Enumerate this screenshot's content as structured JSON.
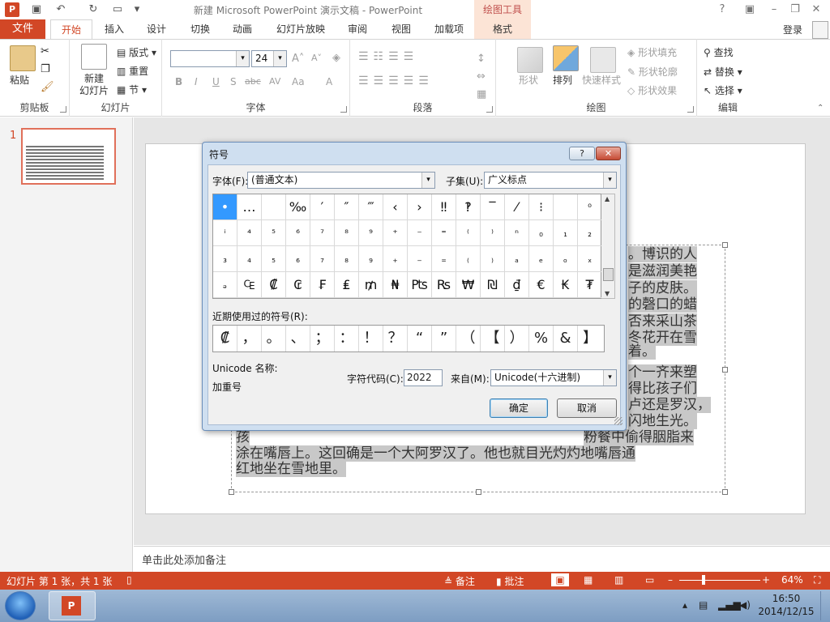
{
  "window": {
    "title": "新建 Microsoft PowerPoint 演示文稿 - PowerPoint",
    "contextual_tab_group": "绘图工具",
    "help": "?",
    "login": "登录"
  },
  "tabs": [
    "文件",
    "开始",
    "插入",
    "设计",
    "切换",
    "动画",
    "幻灯片放映",
    "审阅",
    "视图",
    "加载项",
    "格式"
  ],
  "ribbon": {
    "clipboard": {
      "label": "剪贴板",
      "paste": "粘贴"
    },
    "slides": {
      "label": "幻灯片",
      "new_slide": "新建\n幻灯片",
      "layout": "版式",
      "reset": "重置",
      "section": "节"
    },
    "font": {
      "label": "字体",
      "size": "24",
      "bold": "B",
      "italic": "I",
      "underline": "U",
      "shadow": "S",
      "strike": "abc",
      "spacing": "AV",
      "case": "Aa",
      "color": "A"
    },
    "paragraph": {
      "label": "段落"
    },
    "drawing": {
      "label": "绘图",
      "shapes": "形状",
      "arrange": "排列",
      "quick_styles": "快速样式",
      "fill": "形状填充",
      "outline": "形状轮廓",
      "effects": "形状效果"
    },
    "editing": {
      "label": "编辑",
      "find": "查找",
      "replace": "替换",
      "select": "选择"
    }
  },
  "slide_pane": {
    "slide_number": "1"
  },
  "slide": {
    "lines": [
      "。博识的人",
      "是滋润美艳",
      "子的皮肤。",
      "的磬口的蜡",
      "否来采山茶",
      "冬花开在雪",
      "着。",
      "个一齐来塑",
      "得比孩子们",
      "卢还是罗汉，",
      "闪地生光。",
      "孩",
      "粉餐中偷得胭脂来",
      "涂在嘴唇上。这回确是一个大阿罗汉了。他也就目光灼灼地嘴唇通",
      "红地坐在雪地里。"
    ]
  },
  "notes": {
    "placeholder": "单击此处添加备注"
  },
  "statusbar": {
    "slide_info": "幻灯片 第 1 张，共 1 张",
    "notes": "备注",
    "comments": "批注",
    "zoom": "64%"
  },
  "taskbar": {
    "time": "16:50",
    "date": "2014/12/15"
  },
  "dialog": {
    "title": "符号",
    "help_button": "?",
    "close_button": "✕",
    "font_label": "字体(F):",
    "font_value": "(普通文本)",
    "subset_label": "子集(U):",
    "subset_value": "广义标点",
    "symbols": [
      [
        "•",
        "…",
        "",
        "‰",
        "′",
        "″",
        "‴",
        "‹",
        "›",
        "‼",
        "‽",
        "‾",
        "⁄",
        "⁝",
        "",
        "⁰"
      ],
      [
        "ⁱ",
        "⁴",
        "⁵",
        "⁶",
        "⁷",
        "⁸",
        "⁹",
        "⁺",
        "⁻",
        "⁼",
        "⁽",
        "⁾",
        "ⁿ",
        "₀",
        "₁",
        "₂"
      ],
      [
        "₃",
        "₄",
        "₅",
        "₆",
        "₇",
        "₈",
        "₉",
        "₊",
        "₋",
        "₌",
        "₍",
        "₎",
        "ₐ",
        "ₑ",
        "ₒ",
        "ₓ"
      ],
      [
        "ₔ",
        "₠",
        "₡",
        "₢",
        "₣",
        "₤",
        "₥",
        "₦",
        "₧",
        "₨",
        "₩",
        "₪",
        "₫",
        "€",
        "₭",
        "₮"
      ]
    ],
    "recent_label": "近期使用过的符号(R):",
    "recent_symbols": [
      "₡",
      "，",
      "。",
      "、",
      "；",
      "：",
      "！",
      "？",
      "“",
      "”",
      "（",
      "【",
      "）",
      "%",
      "&",
      "】"
    ],
    "unicode_name_label": "Unicode 名称:",
    "unicode_name_value": "加重号",
    "char_code_label": "字符代码(C):",
    "char_code_value": "2022",
    "from_label": "来自(M):",
    "from_value": "Unicode(十六进制)",
    "ok": "确定",
    "cancel": "取消"
  }
}
